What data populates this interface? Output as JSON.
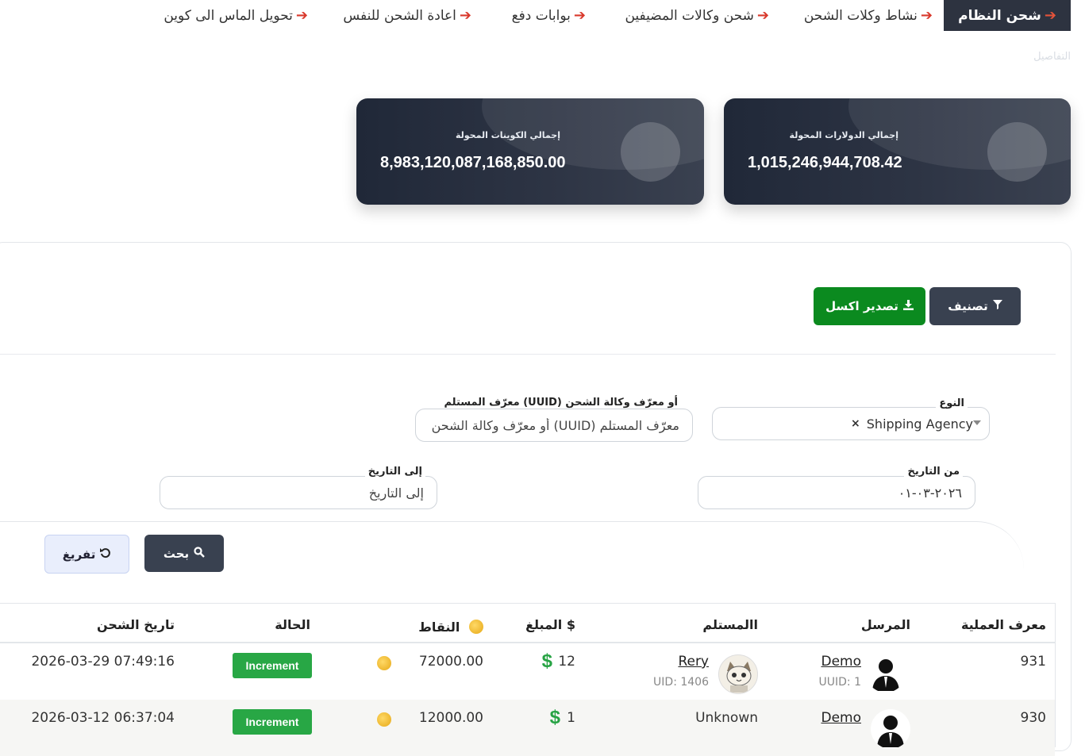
{
  "nav": {
    "items": [
      {
        "label": "شحن النظام",
        "active": true
      },
      {
        "label": "نشاط وكلات الشحن"
      },
      {
        "label": "شحن وكالات المضيفين"
      },
      {
        "label": "بوابات دفع"
      },
      {
        "label": "اعادة الشحن للنفس"
      },
      {
        "label": "تحويل الماس الى كوين"
      }
    ],
    "details": "التفاصيل"
  },
  "stats": {
    "dollars": {
      "label": "إجمالي الدولارات المحولة",
      "value": "1,015,246,944,708.42"
    },
    "coins": {
      "label": "إجمالي الكوينات المحولة",
      "value": "8,983,120,087,168,850.00"
    }
  },
  "actions": {
    "classify": "تصنيف",
    "export": "تصدير اكسل"
  },
  "filters": {
    "type": {
      "label": "النوع",
      "value": "Shipping Agency"
    },
    "receiver": {
      "label": "معرّف المستلم (UUID) أو معرّف وكالة الشحن",
      "placeholder": "معرّف المستلم (UUID) أو معرّف وكالة الشحن"
    },
    "from_date": {
      "label": "من التاريخ",
      "value": "٢٠٢٦-٠٣-٠١"
    },
    "to_date": {
      "label": "إلى التاريخ",
      "placeholder": "إلى التاريخ"
    },
    "search": "بحث",
    "reset": "تفريغ"
  },
  "table": {
    "headers": {
      "id": "معرف العملية",
      "sender": "المرسل",
      "receiver": "االمستلم",
      "amount": "المبلغ $",
      "points": "النقاط",
      "status": "الحالة",
      "date": "تاريخ الشحن"
    },
    "rows": [
      {
        "id": "931",
        "sender": "Demo",
        "sender_sub": "UUID: 1",
        "receiver": "Rery",
        "receiver_sub": "UID: 1406",
        "amount": "12",
        "points": "72000.00",
        "status": "Increment",
        "date": "2026-03-29 07:49:16"
      },
      {
        "id": "930",
        "sender": "Demo",
        "sender_sub": "",
        "receiver": "Unknown",
        "receiver_sub": "",
        "amount": "1",
        "points": "12000.00",
        "status": "Increment",
        "date": "2026-03-12 06:37:04"
      }
    ]
  },
  "colors": {
    "primary_dark": "#2d3340",
    "success": "#28a745",
    "export_green": "#0b8a1f",
    "nav_arrow": "#d9392c"
  }
}
